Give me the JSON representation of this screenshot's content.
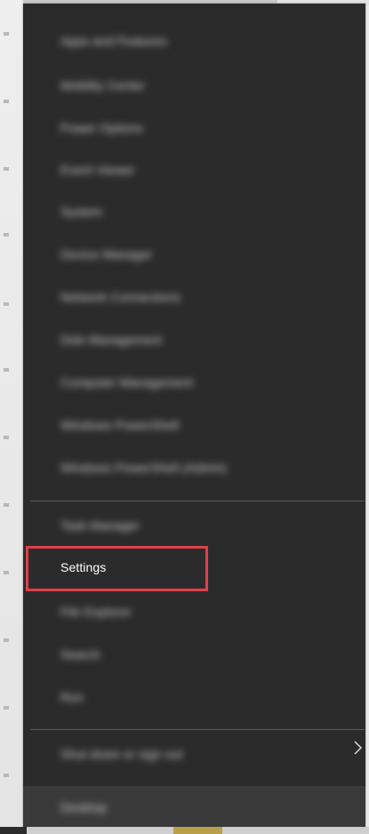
{
  "menu": {
    "items": [
      {
        "label": "Apps and Features"
      },
      {
        "label": "Mobility Center"
      },
      {
        "label": "Power Options"
      },
      {
        "label": "Event Viewer"
      },
      {
        "label": "System"
      },
      {
        "label": "Device Manager"
      },
      {
        "label": "Network Connections"
      },
      {
        "label": "Disk Management"
      },
      {
        "label": "Computer Management"
      },
      {
        "label": "Windows PowerShell"
      },
      {
        "label": "Windows PowerShell (Admin)"
      },
      {
        "label": "Task Manager"
      },
      {
        "label": "Settings"
      },
      {
        "label": "File Explorer"
      },
      {
        "label": "Search"
      },
      {
        "label": "Run"
      },
      {
        "label": "Shut down or sign out"
      },
      {
        "label": "Desktop"
      }
    ],
    "highlight_color": "#e0404a",
    "background_color": "#2b2b2b"
  },
  "icons": {
    "submenu_chevron": "chevron-right-icon"
  }
}
